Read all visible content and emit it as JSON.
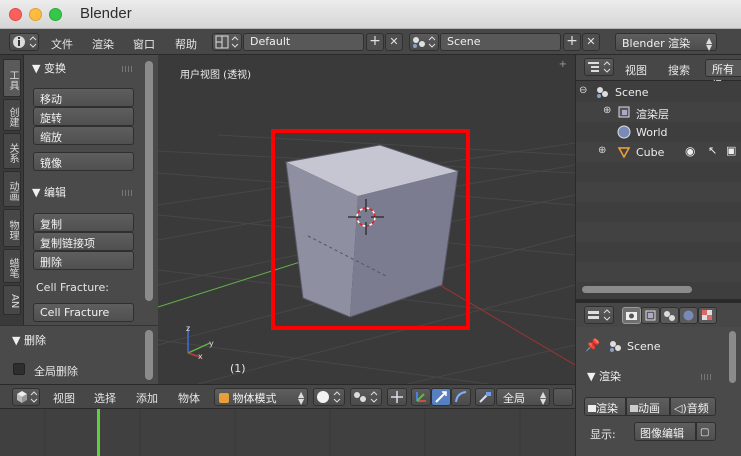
{
  "window": {
    "title": "Blender"
  },
  "info_header": {
    "menus": [
      "文件",
      "渲染",
      "窗口",
      "帮助"
    ],
    "screen_layout": "Default",
    "scene_name": "Scene",
    "render_engine": "Blender 渲染"
  },
  "toolshelf": {
    "tabs": [
      "工具",
      "创建",
      "关系",
      "动画",
      "物理",
      "蜡笔",
      "AN"
    ],
    "transform_panel": {
      "title": "变换",
      "buttons": [
        "移动",
        "旋转",
        "缩放",
        "镜像"
      ]
    },
    "edit_panel": {
      "title": "编辑",
      "buttons": [
        "复制",
        "复制链接项",
        "删除"
      ],
      "extra_label": "Cell Fracture:",
      "extra_button": "Cell Fracture"
    },
    "operator_panel": {
      "title": "删除",
      "checkbox_label": "全局删除"
    }
  },
  "viewport": {
    "label": "用户视图 (透视)",
    "frame": "(1)",
    "highlight_color": "#ff0000"
  },
  "view3d_header": {
    "menus": [
      "视图",
      "选择",
      "添加",
      "物体"
    ],
    "mode": "物体模式",
    "orientation": "全局"
  },
  "outliner": {
    "header": {
      "view_menu": "视图",
      "search_menu": "搜索",
      "filter": "所有场"
    },
    "items": [
      {
        "name": "Scene",
        "icon": "scene-icon"
      },
      {
        "name": "渲染层",
        "icon": "render-layer-icon"
      },
      {
        "name": "World",
        "icon": "world-icon"
      },
      {
        "name": "Cube",
        "icon": "mesh-object-icon"
      }
    ]
  },
  "properties": {
    "context": "Scene",
    "render_panel": {
      "title": "渲染",
      "buttons": [
        "渲染",
        "动画",
        "音频"
      ],
      "display_label": "显示:",
      "display_value": "图像编辑"
    }
  },
  "colors": {
    "accent_blue": "#5680c2",
    "grid": "#444444",
    "x_axis": "#b53a3a",
    "y_axis": "#62b54a"
  }
}
